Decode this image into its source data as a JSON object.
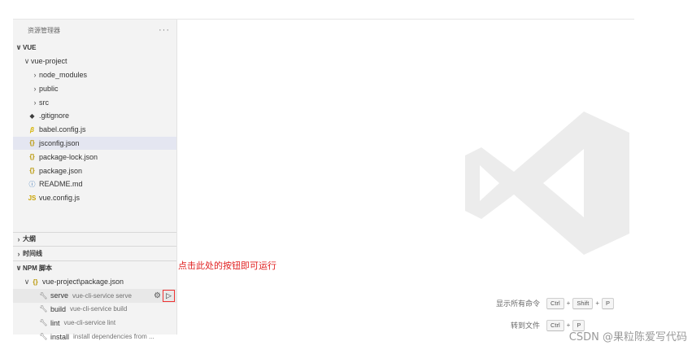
{
  "sidebar": {
    "title": "资源管理器",
    "more_label": "···",
    "workspace": "VUE",
    "project": "vue-project",
    "tree": [
      {
        "type": "folder",
        "label": "node_modules",
        "icon": "chevron-right-icon"
      },
      {
        "type": "folder",
        "label": "public",
        "icon": "chevron-right-icon"
      },
      {
        "type": "folder",
        "label": "src",
        "icon": "chevron-right-icon"
      },
      {
        "type": "file",
        "label": ".gitignore",
        "icon": "git-file-icon"
      },
      {
        "type": "file",
        "label": "babel.config.js",
        "icon": "babel-file-icon"
      },
      {
        "type": "file",
        "label": "jsconfig.json",
        "icon": "json-file-icon",
        "selected": true
      },
      {
        "type": "file",
        "label": "package-lock.json",
        "icon": "json-file-icon"
      },
      {
        "type": "file",
        "label": "package.json",
        "icon": "json-file-icon"
      },
      {
        "type": "file",
        "label": "README.md",
        "icon": "info-file-icon"
      },
      {
        "type": "file",
        "label": "vue.config.js",
        "icon": "js-file-icon"
      }
    ],
    "sections": {
      "outline": "大纲",
      "timeline": "时间线",
      "npm": "NPM 脚本"
    },
    "npm_package": "vue-project\\package.json",
    "scripts": [
      {
        "name": "serve",
        "command": "vue-cli-service serve"
      },
      {
        "name": "build",
        "command": "vue-cli-service build"
      },
      {
        "name": "lint",
        "command": "vue-cli-service lint"
      },
      {
        "name": "install",
        "command": "install dependencies from ..."
      }
    ]
  },
  "annotation": "点击此处的按钮即可运行",
  "shortcuts": [
    {
      "label": "显示所有命令",
      "keys": [
        "Ctrl",
        "Shift",
        "P"
      ]
    },
    {
      "label": "转到文件",
      "keys": [
        "Ctrl",
        "P"
      ]
    }
  ],
  "watermark": "CSDN @果粒陈爱写代码",
  "colors": {
    "sidebar_bg": "#f3f3f3",
    "selected_bg": "#e4e6f1",
    "annotation": "#e02020",
    "logo": "#ececec"
  }
}
